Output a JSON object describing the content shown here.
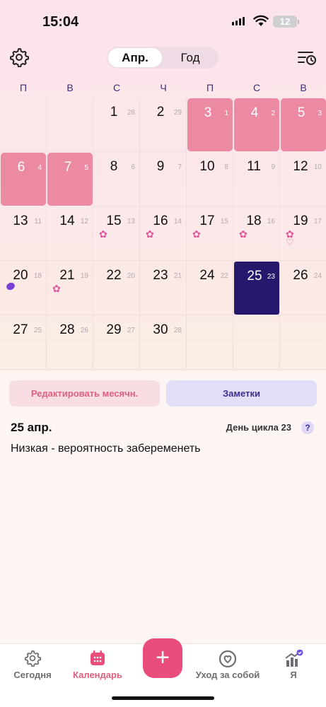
{
  "status_bar": {
    "time": "15:04",
    "battery": "12"
  },
  "header": {
    "segments": [
      "Апр.",
      "Год"
    ]
  },
  "weekdays": [
    "П",
    "В",
    "С",
    "Ч",
    "П",
    "С",
    "В"
  ],
  "calendar": {
    "days": [
      {
        "day": "1",
        "cycle": "28",
        "type": "normal"
      },
      {
        "day": "2",
        "cycle": "29",
        "type": "normal"
      },
      {
        "day": "3",
        "cycle": "1",
        "type": "period"
      },
      {
        "day": "4",
        "cycle": "2",
        "type": "period"
      },
      {
        "day": "5",
        "cycle": "3",
        "type": "period"
      },
      {
        "day": "6",
        "cycle": "4",
        "type": "period"
      },
      {
        "day": "7",
        "cycle": "5",
        "type": "period"
      },
      {
        "day": "8",
        "cycle": "6",
        "type": "normal"
      },
      {
        "day": "9",
        "cycle": "7",
        "type": "normal"
      },
      {
        "day": "10",
        "cycle": "8",
        "type": "normal"
      },
      {
        "day": "11",
        "cycle": "9",
        "type": "normal"
      },
      {
        "day": "12",
        "cycle": "10",
        "type": "normal"
      },
      {
        "day": "13",
        "cycle": "11",
        "type": "normal"
      },
      {
        "day": "14",
        "cycle": "12",
        "type": "normal"
      },
      {
        "day": "15",
        "cycle": "13",
        "type": "normal",
        "marker": "flower"
      },
      {
        "day": "16",
        "cycle": "14",
        "type": "normal",
        "marker": "flower"
      },
      {
        "day": "17",
        "cycle": "15",
        "type": "normal",
        "marker": "flower"
      },
      {
        "day": "18",
        "cycle": "16",
        "type": "normal",
        "marker": "flower"
      },
      {
        "day": "19",
        "cycle": "17",
        "type": "normal",
        "marker": "flower-heart"
      },
      {
        "day": "20",
        "cycle": "18",
        "type": "normal",
        "marker": "ovulation"
      },
      {
        "day": "21",
        "cycle": "19",
        "type": "normal",
        "marker": "flower"
      },
      {
        "day": "22",
        "cycle": "20",
        "type": "normal"
      },
      {
        "day": "23",
        "cycle": "21",
        "type": "normal"
      },
      {
        "day": "24",
        "cycle": "22",
        "type": "normal"
      },
      {
        "day": "25",
        "cycle": "23",
        "type": "today"
      },
      {
        "day": "26",
        "cycle": "24",
        "type": "normal"
      },
      {
        "day": "27",
        "cycle": "25",
        "type": "normal"
      },
      {
        "day": "28",
        "cycle": "26",
        "type": "normal"
      },
      {
        "day": "29",
        "cycle": "27",
        "type": "normal"
      },
      {
        "day": "30",
        "cycle": "28",
        "type": "normal"
      }
    ],
    "first_weekday_index": 2
  },
  "actions": {
    "edit_period": "Редактировать месячн.",
    "notes": "Заметки"
  },
  "selected": {
    "date": "25 апр.",
    "cycle_day": "День цикла 23",
    "help": "?",
    "probability": "Низкая - вероятность забеременеть"
  },
  "tabbar": {
    "items": [
      {
        "label": "Сегодня",
        "icon": "gear-icon"
      },
      {
        "label": "Календарь",
        "icon": "calendar-icon"
      },
      {
        "label": "Уход за собой",
        "icon": "heart-circle-icon"
      },
      {
        "label": "Я",
        "icon": "chart-icon"
      }
    ],
    "add": "+"
  },
  "colors": {
    "period": "#ec8aa4",
    "today": "#26186c",
    "accent": "#e84d7c"
  }
}
